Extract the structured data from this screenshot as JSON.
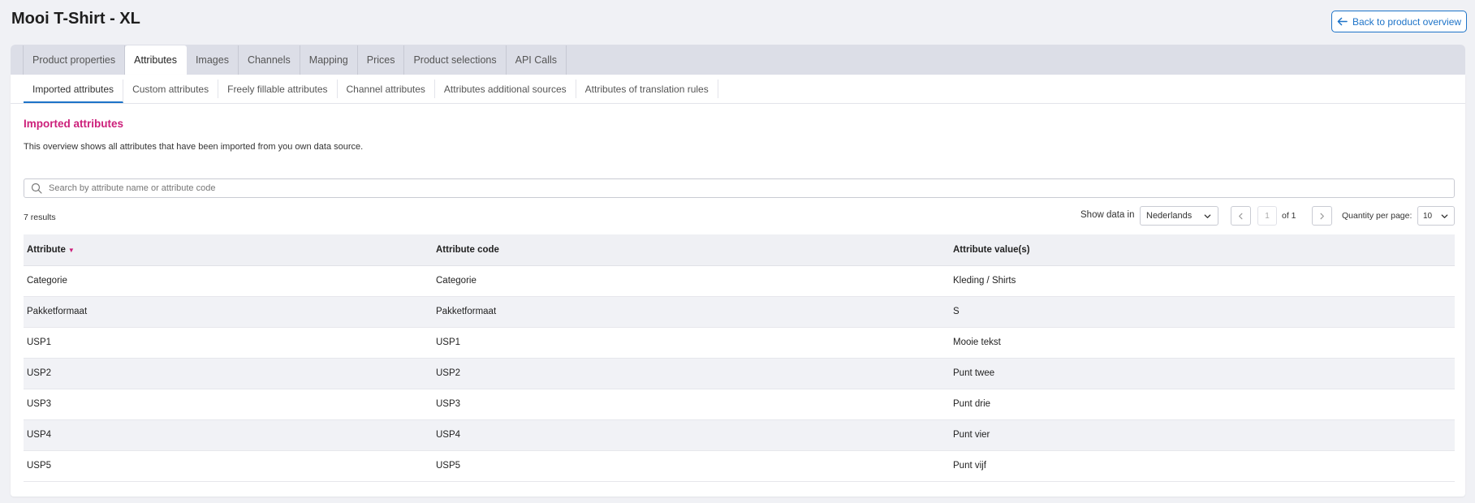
{
  "header": {
    "title": "Mooi T-Shirt - XL",
    "back_label": "Back to product overview"
  },
  "tabs": [
    "Product properties",
    "Attributes",
    "Images",
    "Channels",
    "Mapping",
    "Prices",
    "Product selections",
    "API Calls"
  ],
  "active_tab": "Attributes",
  "subtabs": [
    "Imported attributes",
    "Custom attributes",
    "Freely fillable attributes",
    "Channel attributes",
    "Attributes additional sources",
    "Attributes of translation rules"
  ],
  "active_subtab": "Imported attributes",
  "section": {
    "title": "Imported attributes",
    "description": "This overview shows all attributes that have been imported from you own data source."
  },
  "search": {
    "placeholder": "Search by attribute name or attribute code"
  },
  "toolbar": {
    "results": "7 results",
    "show_data_label": "Show data in",
    "language": "Nederlands",
    "page": "1",
    "of_label": "of 1",
    "quantity_label": "Quantity per page:",
    "quantity": "10"
  },
  "table": {
    "headers": [
      "Attribute",
      "Attribute code",
      "Attribute value(s)"
    ],
    "rows": [
      [
        "Categorie",
        "Categorie",
        "Kleding / Shirts"
      ],
      [
        "Pakketformaat",
        "Pakketformaat",
        "S"
      ],
      [
        "USP1",
        "USP1",
        "Mooie tekst"
      ],
      [
        "USP2",
        "USP2",
        "Punt twee"
      ],
      [
        "USP3",
        "USP3",
        "Punt drie"
      ],
      [
        "USP4",
        "USP4",
        "Punt vier"
      ],
      [
        "USP5",
        "USP5",
        "Punt vijf"
      ]
    ]
  },
  "colors": {
    "accent_blue": "#1d73c8",
    "section_title": "#cc1f7a",
    "background": "#f0f1f5"
  }
}
